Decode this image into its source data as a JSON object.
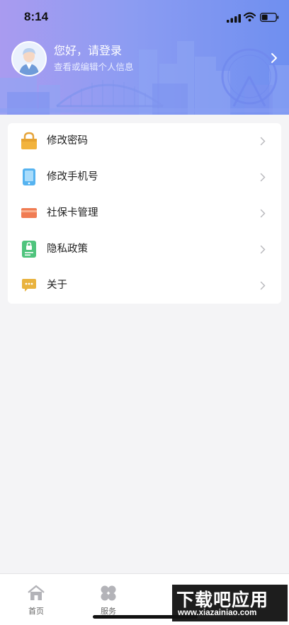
{
  "status_bar": {
    "time": "8:14"
  },
  "profile": {
    "greeting": "您好，请登录",
    "subtitle": "查看或编辑个人信息"
  },
  "menu": {
    "items": [
      {
        "label": "修改密码",
        "icon": "lock-icon"
      },
      {
        "label": "修改手机号",
        "icon": "phone-icon"
      },
      {
        "label": "社保卡管理",
        "icon": "card-icon"
      },
      {
        "label": "隐私政策",
        "icon": "privacy-doc-icon"
      },
      {
        "label": "关于",
        "icon": "chat-bubble-icon"
      }
    ]
  },
  "tabbar": {
    "tabs": [
      {
        "label": "首页",
        "icon": "home-icon"
      },
      {
        "label": "服务",
        "icon": "services-icon"
      }
    ]
  },
  "watermark": {
    "title": "下载吧应用",
    "url": "www.xiazainiao.com"
  },
  "colors": {
    "header_gradient_start": "#a99bf0",
    "header_gradient_end": "#6f8ff0",
    "background": "#f4f4f6",
    "card": "#ffffff"
  }
}
